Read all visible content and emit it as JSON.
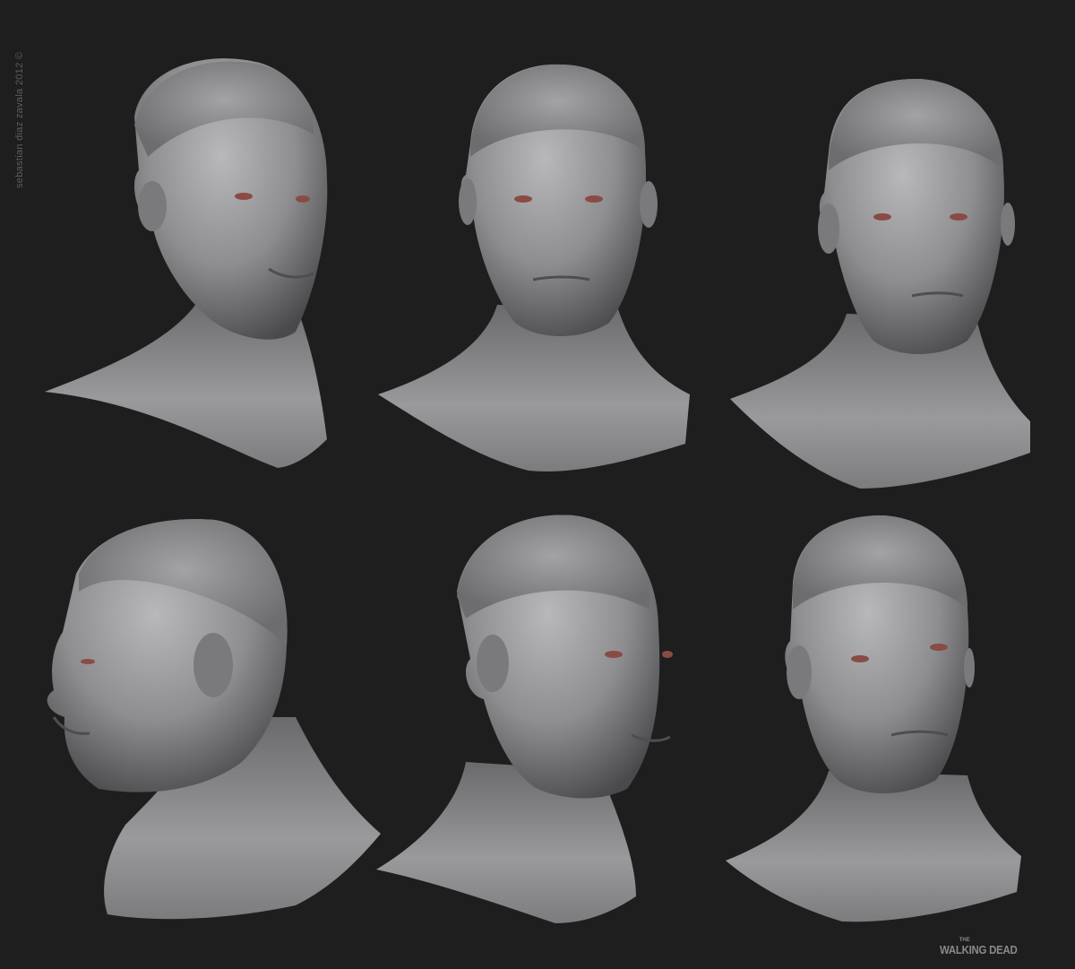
{
  "watermark": {
    "text": "sebastian diaz zavala 2012 ©"
  },
  "logo": {
    "small": "THE",
    "main": "WALKING DEAD"
  },
  "colors": {
    "background": "#1e1e1f",
    "clay": "#8d8d90",
    "clay_light": "#b4b4b7",
    "clay_dark": "#505053",
    "eye": "#8a4b45"
  },
  "busts": [
    {
      "view": "three-quarter-right"
    },
    {
      "view": "front"
    },
    {
      "view": "front-slight-left"
    },
    {
      "view": "left-profile"
    },
    {
      "view": "three-quarter-right-lowered"
    },
    {
      "view": "front-slight-right"
    }
  ]
}
